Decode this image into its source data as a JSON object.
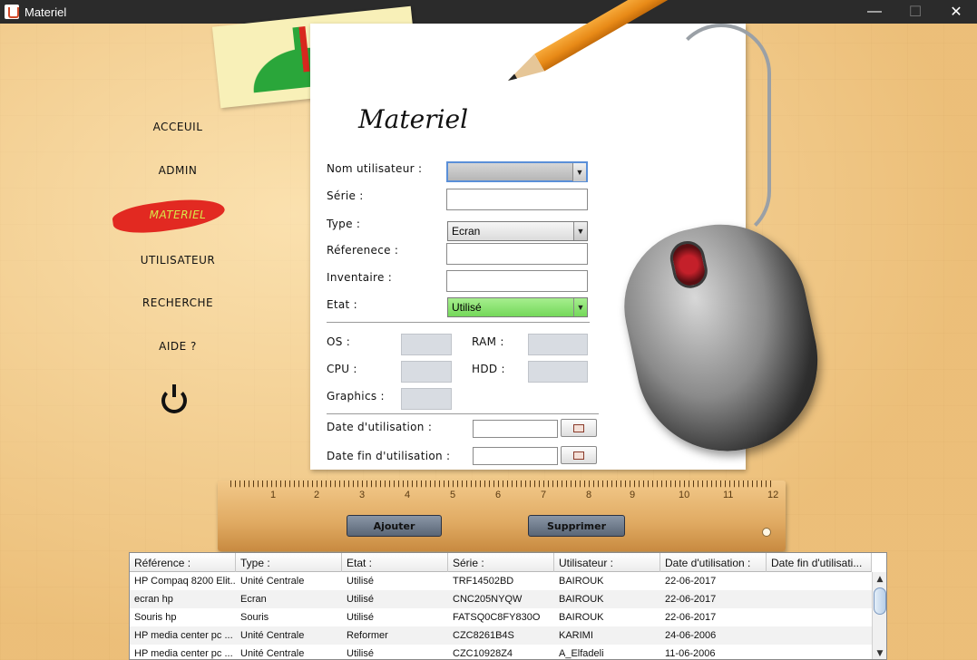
{
  "window": {
    "title": "Materiel",
    "min_glyph": "—",
    "max_glyph": "☐",
    "close_glyph": "✕"
  },
  "page_heading": "Materiel",
  "menu": [
    {
      "label": "ACCEUIL",
      "active": false
    },
    {
      "label": "ADMIN",
      "active": false
    },
    {
      "label": "MATERIEL",
      "active": true
    },
    {
      "label": "UTILISATEUR",
      "active": false
    },
    {
      "label": "RECHERCHE",
      "active": false
    },
    {
      "label": "AIDE ?",
      "active": false
    }
  ],
  "form": {
    "nom_utilisateur": {
      "label": "Nom utilisateur :",
      "value": ""
    },
    "serie": {
      "label": "Série :",
      "value": ""
    },
    "type": {
      "label": "Type :",
      "value": "Ecran"
    },
    "reference": {
      "label": "Réferenece :",
      "value": ""
    },
    "inventaire": {
      "label": "Inventaire :",
      "value": ""
    },
    "etat": {
      "label": "Etat :",
      "value": "Utilisé"
    },
    "os": {
      "label": "OS :"
    },
    "ram": {
      "label": "RAM :"
    },
    "cpu": {
      "label": "CPU :"
    },
    "hdd": {
      "label": "HDD :"
    },
    "graphics": {
      "label": "Graphics :"
    },
    "date_utilisation": {
      "label": "Date d'utilisation :",
      "value": ""
    },
    "date_fin_utilisation": {
      "label": "Date fin d'utilisation :",
      "value": ""
    },
    "dropdown_arrow": "▼"
  },
  "ruler": {
    "numbers": [
      "1",
      "2",
      "3",
      "4",
      "5",
      "6",
      "7",
      "8",
      "9",
      "10",
      "11",
      "12"
    ]
  },
  "buttons": {
    "ajouter": "Ajouter",
    "supprimer": "Supprimer"
  },
  "table": {
    "columns": [
      "Référence :",
      "Type :",
      "Etat :",
      "Série :",
      "Utilisateur :",
      "Date d'utilisation :",
      "Date fin d'utilisati..."
    ],
    "rows": [
      [
        "HP Compaq 8200 Elit...",
        "Unité Centrale",
        "Utilisé",
        "TRF14502BD",
        "BAIROUK",
        "22-06-2017",
        ""
      ],
      [
        "ecran hp",
        "Ecran",
        "Utilisé",
        "CNC205NYQW",
        "BAIROUK",
        "22-06-2017",
        ""
      ],
      [
        "Souris hp",
        "Souris",
        "Utilisé",
        " FATSQ0C8FY830O",
        "BAIROUK",
        "22-06-2017",
        ""
      ],
      [
        "HP media center pc ...",
        "Unité Centrale",
        "Reformer",
        "CZC8261B4S",
        "KARIMI",
        "24-06-2006",
        ""
      ],
      [
        "HP media center pc ...",
        "Unité Centrale",
        "Utilisé",
        "CZC10928Z4",
        "A_Elfadeli",
        "11-06-2006",
        ""
      ]
    ],
    "scroll_up": "▲",
    "scroll_down": "▼"
  }
}
